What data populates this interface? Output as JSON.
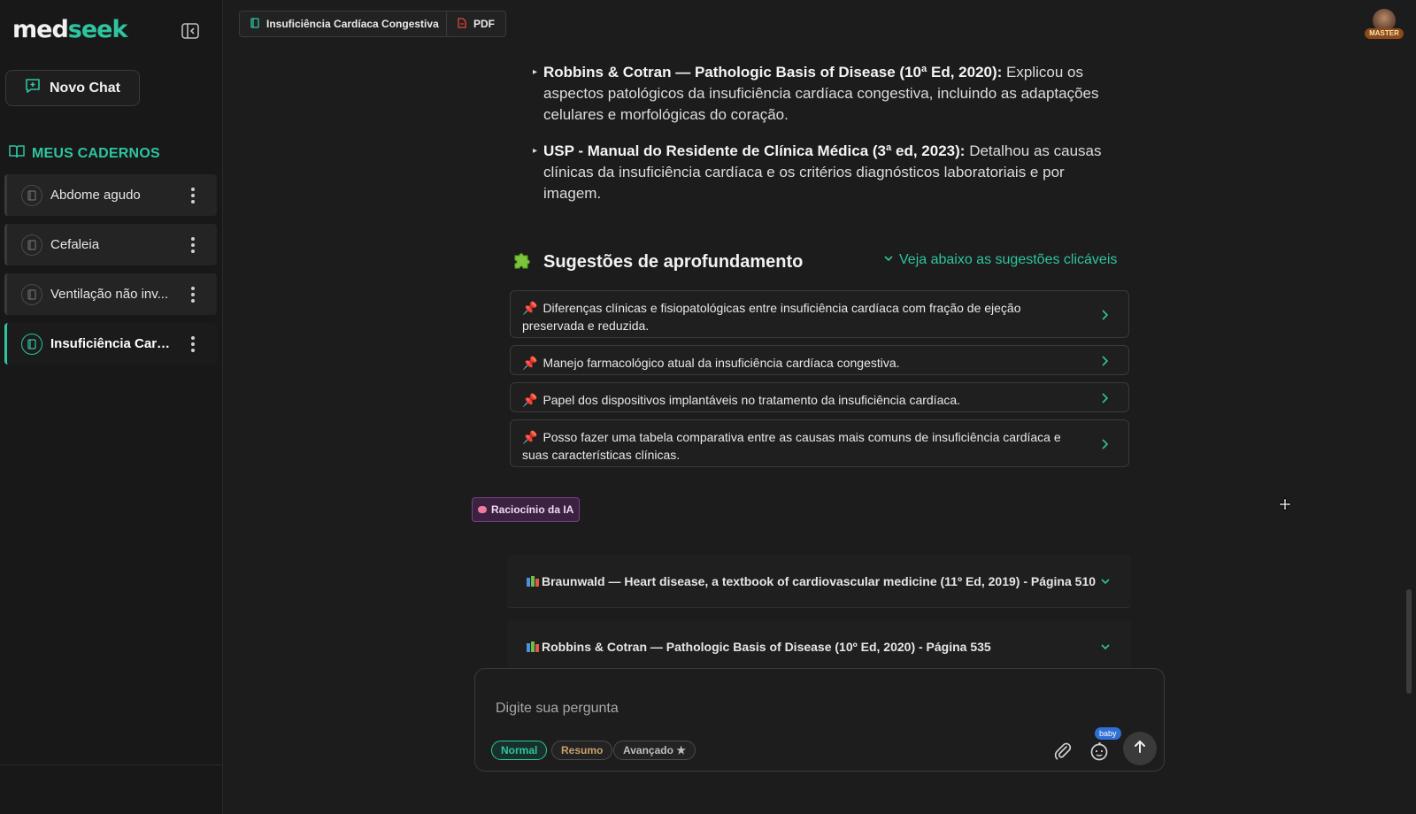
{
  "sidebar": {
    "logo_part1": "med",
    "logo_part2": "seek",
    "new_chat_label": "Novo Chat",
    "section_title": "MEUS CADERNOS",
    "notebooks": [
      {
        "label": "Abdome agudo",
        "active": false
      },
      {
        "label": "Cefaleia",
        "active": false
      },
      {
        "label": "Ventilação não inv...",
        "active": false
      },
      {
        "label": "Insuficiência Card...",
        "active": true
      }
    ]
  },
  "topbar": {
    "notebook_tab": "Insuficiência Cardíaca Congestiva",
    "pdf_tab": "PDF",
    "avatar_badge": "MASTER"
  },
  "references": [
    {
      "title": "Robbins & Cotran — Pathologic Basis of Disease (10ª Ed, 2020):",
      "text": "Explicou os aspectos patológicos da insuficiência cardíaca congestiva, incluindo as adaptações celulares e morfológicas do coração."
    },
    {
      "title": "USP - Manual do Residente de Clínica Médica (3ª ed, 2023):",
      "text": "Detalhou as causas clínicas da insuficiência cardíaca e os critérios diagnósticos laboratoriais e por imagem."
    }
  ],
  "suggestions": {
    "title": "Sugestões de aprofundamento",
    "hint": "Veja abaixo as sugestões clicáveis",
    "items": [
      "Diferenças clínicas e fisiopatológicas entre insuficiência cardíaca com fração de ejeção preservada e reduzida.",
      "Manejo farmacológico atual da insuficiência cardíaca congestiva.",
      "Papel dos dispositivos implantáveis no tratamento da insuficiência cardíaca.",
      "Posso fazer uma tabela comparativa entre as causas mais comuns de insuficiência cardíaca e suas características clínicas."
    ]
  },
  "ai_reasoning_label": "Raciocínio da IA",
  "sources": [
    "Braunwald — Heart disease, a textbook of cardiovascular medicine (11º Ed, 2019) - Página 510",
    "Robbins & Cotran — Pathologic Basis of Disease (10º Ed, 2020) - Página 535"
  ],
  "composer": {
    "placeholder": "Digite sua pergunta",
    "modes": [
      "Normal",
      "Resumo",
      "Avançado ★"
    ],
    "baby_badge": "baby"
  },
  "colors": {
    "accent": "#2ec4a0",
    "background": "#1c1c1c",
    "sidebar": "#181818",
    "pin": "#e0463c"
  },
  "icons": [
    "sidebar-collapse-icon",
    "chat-plus-icon",
    "book-open-icon",
    "notebook-icon",
    "kebab-icon",
    "pdf-icon",
    "puzzle-icon",
    "chevron-right-icon",
    "chevron-down-icon",
    "paperclip-icon",
    "baby-face-icon",
    "arrow-up-icon",
    "move-cursor-icon"
  ]
}
